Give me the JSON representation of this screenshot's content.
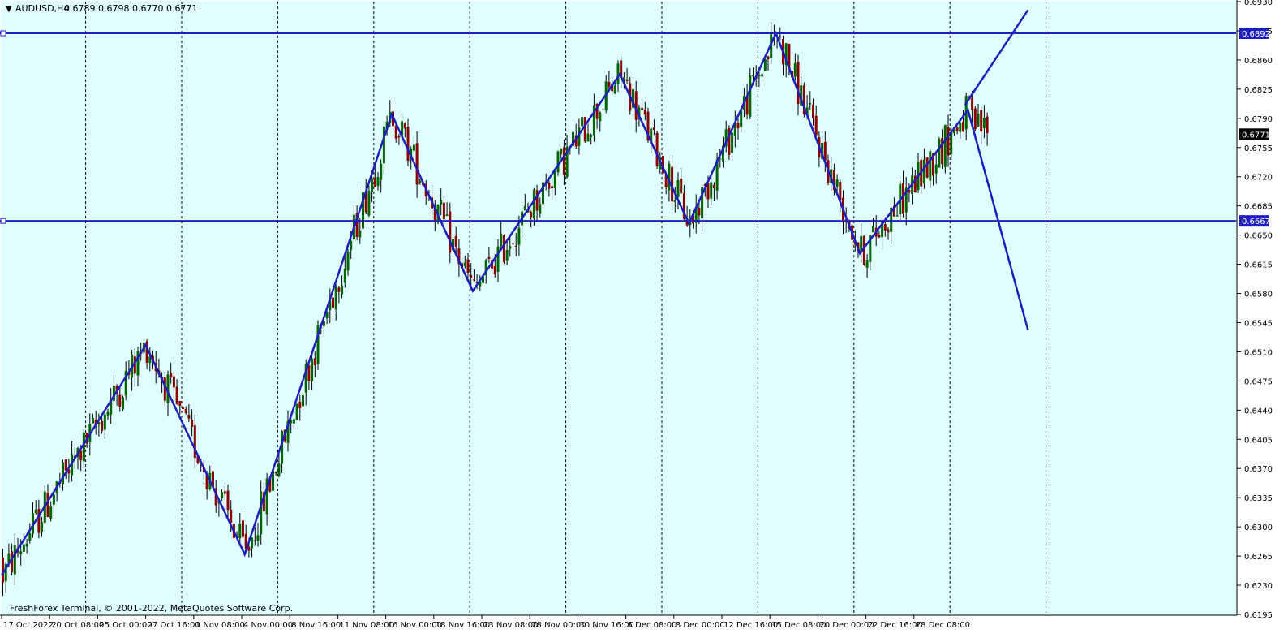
{
  "header": {
    "symbol": "AUDUSD,H4",
    "ohlc": "0.6789 0.6798 0.6770 0.6771",
    "menu_glyph": "▼"
  },
  "watermark": "FreshForex Terminal, © 2001-2022, MetaQuotes Software Corp.",
  "colors": {
    "background": "#e0ffff",
    "grid": "#000000",
    "bull_candle": "#006400",
    "bear_candle": "#8b0000",
    "wick": "#000000",
    "zigzag": "#1e1ebe",
    "level_line": "#1e1ebe",
    "price_badge": "#000000"
  },
  "chart_data": {
    "type": "candlestick",
    "ylim": [
      0.6195,
      0.693
    ],
    "y_ticks": [
      "0.6930",
      "0.6895",
      "0.6860",
      "0.6825",
      "0.6790",
      "0.6755",
      "0.6720",
      "0.6685",
      "0.6650",
      "0.6615",
      "0.6580",
      "0.6545",
      "0.6510",
      "0.6475",
      "0.6440",
      "0.6405",
      "0.6370",
      "0.6335",
      "0.6300",
      "0.6265",
      "0.6230",
      "0.6195"
    ],
    "x_labels": [
      "17 Oct 2022",
      "20 Oct 08:00",
      "25 Oct 00:00",
      "27 Oct 16:00",
      "1 Nov 08:00",
      "4 Nov 00:00",
      "8 Nov 16:00",
      "11 Nov 08:00",
      "16 Nov 00:00",
      "18 Nov 16:00",
      "23 Nov 08:00",
      "28 Nov 00:00",
      "30 Nov 16:00",
      "5 Dec 08:00",
      "8 Dec 00:00",
      "12 Dec 16:00",
      "15 Dec 08:00",
      "20 Dec 00:00",
      "22 Dec 16:00",
      "28 Dec 08:00"
    ],
    "x_label_bars": [
      0,
      16,
      32,
      48,
      64,
      80,
      96,
      112,
      128,
      144,
      160,
      176,
      192,
      208,
      224,
      240,
      256,
      272,
      288,
      304
    ],
    "total_bars": 415,
    "vertical_grid_bars": [
      28,
      60,
      92,
      124,
      156,
      188,
      220,
      252,
      284,
      316,
      348
    ],
    "horizontal_levels": [
      {
        "price": 0.6892,
        "label": "0.6892"
      },
      {
        "price": 0.6667,
        "label": "0.6667"
      }
    ],
    "current_price": {
      "price": 0.6771,
      "label": "0.6771"
    },
    "zigzag": [
      {
        "bar": 0,
        "price": 0.6242
      },
      {
        "bar": 48,
        "price": 0.6518
      },
      {
        "bar": 81,
        "price": 0.6267
      },
      {
        "bar": 130,
        "price": 0.6795
      },
      {
        "bar": 157,
        "price": 0.6583
      },
      {
        "bar": 206,
        "price": 0.6843
      },
      {
        "bar": 229,
        "price": 0.6664
      },
      {
        "bar": 258,
        "price": 0.6892
      },
      {
        "bar": 286,
        "price": 0.6628
      },
      {
        "bar": 322,
        "price": 0.68
      },
      {
        "bar": 342,
        "price": 0.6536
      }
    ],
    "projection_up": [
      {
        "bar": 321,
        "price": 0.6806
      },
      {
        "bar": 342,
        "price": 0.692
      }
    ]
  }
}
